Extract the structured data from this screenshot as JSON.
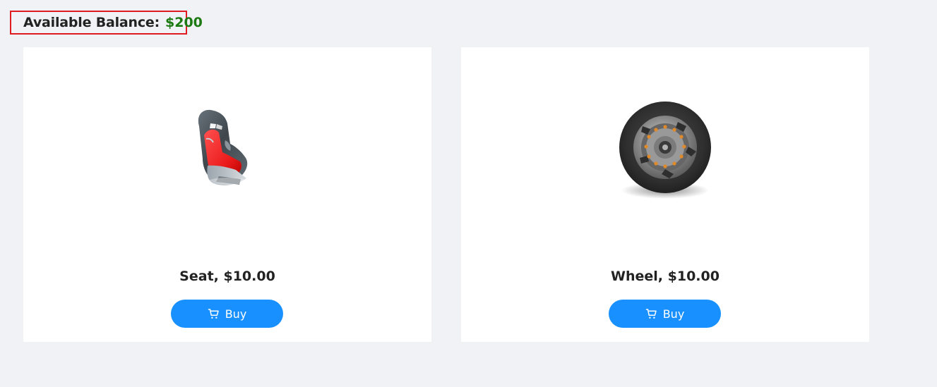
{
  "balance": {
    "label": "Available Balance:",
    "value": "$200",
    "value_color": "#1d7a13",
    "border_color": "#e01b22"
  },
  "products": [
    {
      "title": "Seat, $10.00",
      "button_label": "Buy",
      "button_icon": "cart-icon",
      "image": "seat-image"
    },
    {
      "title": "Wheel, $10.00",
      "button_label": "Buy",
      "button_icon": "cart-icon",
      "image": "wheel-image"
    }
  ],
  "colors": {
    "page_background": "#f0f2f5",
    "card_background": "#ffffff",
    "button_background": "#1890ff"
  }
}
